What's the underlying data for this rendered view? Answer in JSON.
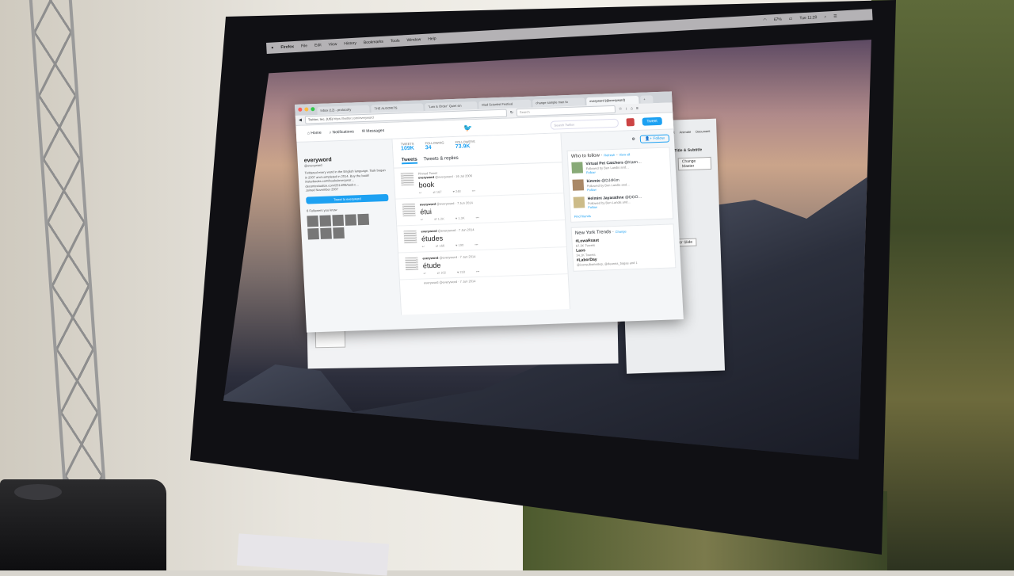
{
  "menubar": {
    "app": "Firefox",
    "items": [
      "File",
      "Edit",
      "View",
      "History",
      "Bookmarks",
      "Tools",
      "Window",
      "Help"
    ],
    "battery": "67%",
    "clock": "Tue 11:20"
  },
  "browser": {
    "tabs": [
      "Inbox (12) - protocolty",
      "THE ALGORITS",
      "\"Law & Order\" Quiet sin",
      "Mad Scientist Festival",
      "change sample men fo",
      "everyword (@everyword)"
    ],
    "url_domain": "Twitter, Inc. (US)",
    "url": "https://twitter.com/everyword",
    "search_placeholder": "Search"
  },
  "twitter": {
    "nav": {
      "home": "Home",
      "notifications": "Notifications",
      "messages": "Messages",
      "search_placeholder": "Search Twitter",
      "tweet_button": "Tweet"
    },
    "profile": {
      "name": "everyword",
      "handle": "@everyword",
      "bio": "Twittered every word in the English language. Task began in 2007 and completed in 2014. Buy the book! instarbooks.com/books/everywor…",
      "link": "decontextualize.com/2014/06/task-c…",
      "joined": "Joined November 2007",
      "tweet_to": "Tweet to everyword",
      "followers_you_know": "6 Followers you know"
    },
    "stats": [
      {
        "label": "TWEETS",
        "value": "109K"
      },
      {
        "label": "FOLLOWING",
        "value": "34"
      },
      {
        "label": "FOLLOWERS",
        "value": "73.9K"
      }
    ],
    "follow_button": "Follow",
    "timeline_tabs": [
      "Tweets",
      "Tweets & replies"
    ],
    "tweets": [
      {
        "pinned": "Pinned Tweet",
        "name": "everyword",
        "handle": "@everyword",
        "date": "16 Jul 2006",
        "text": "book",
        "retweets": "167",
        "likes": "248"
      },
      {
        "pinned": "",
        "name": "everyword",
        "handle": "@everyword",
        "date": "7 Jun 2014",
        "text": "étui",
        "retweets": "1.2K",
        "likes": "1.3K"
      },
      {
        "pinned": "",
        "name": "everyword",
        "handle": "@everyword",
        "date": "7 Jun 2014",
        "text": "études",
        "retweets": "166",
        "likes": "190"
      },
      {
        "pinned": "",
        "name": "everyword",
        "handle": "@everyword",
        "date": "7 Jun 2014",
        "text": "étude",
        "retweets": "102",
        "likes": "218"
      }
    ],
    "last_tweet_meta": "everyword @everyword · 7 Jun 2014",
    "who_to_follow": {
      "title": "Who to follow",
      "refresh": "Refresh",
      "view_all": "View all",
      "suggestions": [
        {
          "name": "Virtual Pet Catchers",
          "handle": "@Kaen…",
          "followed_by": "Followed by Ben Landis and…",
          "action": "Follow"
        },
        {
          "name": "kimmie",
          "handle": "@DJ4Kim",
          "followed_by": "Followed by Ben Landis and…",
          "action": "Follow"
        },
        {
          "name": "Helmini Jayarathne",
          "handle": "@DGO…",
          "followed_by": "Followed by Ben Landis and…",
          "action": "Follow"
        }
      ],
      "find_friends": "Find friends"
    },
    "trends": {
      "title": "New York Trends",
      "change": "Change",
      "items": [
        {
          "tag": "#LowaRoast",
          "count": "67.3K Tweets"
        },
        {
          "tag": "Laos",
          "count": "34.1K Tweets"
        },
        {
          "tag": "#LaborDay",
          "count": "@iconsulbaneslep, @deanna_bagas and 1"
        }
      ]
    }
  },
  "keynote": {
    "toolbar": [
      "Format",
      "Animate",
      "Document"
    ],
    "panel_title": "Slide Layout",
    "title_subtitle": "Title & Subtitle",
    "change_master": "Change Master",
    "master_slide": "Master Slide"
  }
}
